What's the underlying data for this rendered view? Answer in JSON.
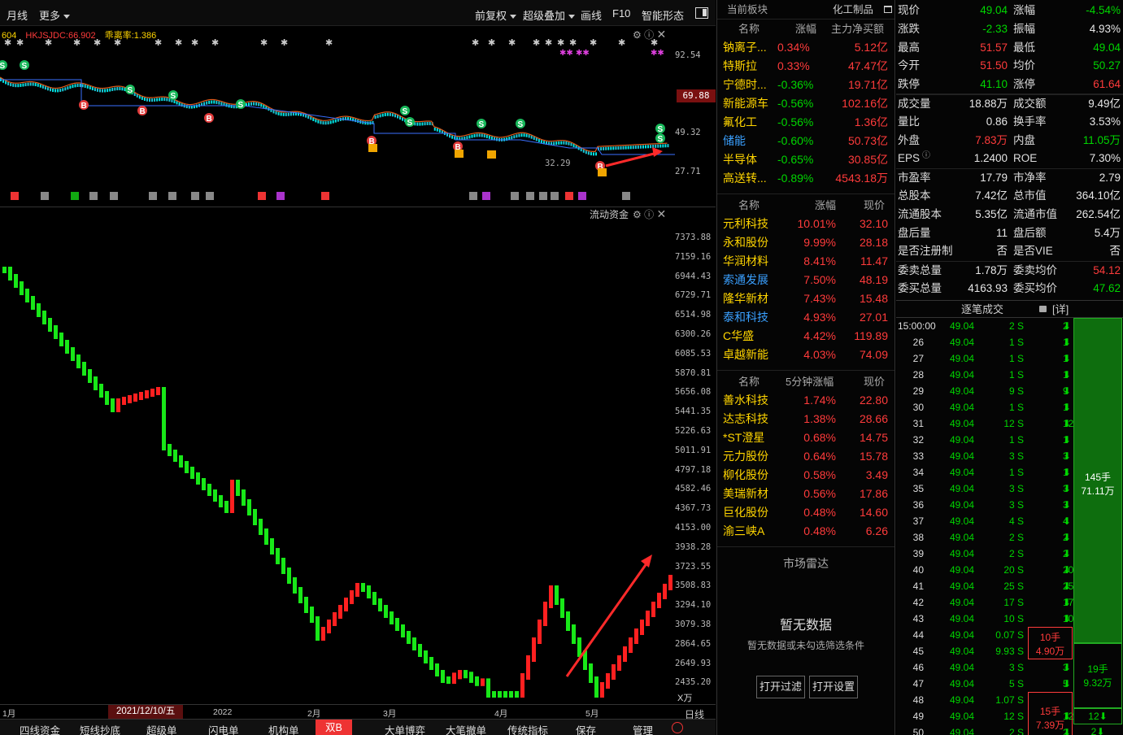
{
  "toolbar": {
    "period": "月线",
    "more": "更多",
    "adjust": "前复权",
    "overlay": "超级叠加",
    "draw": "画线",
    "f10": "F10",
    "smart": "智能形态"
  },
  "upper": {
    "ind_code": "604",
    "ind_name": "HKJSJDC:66.902",
    "ind_bias": "乖离率:1.386",
    "y_labels": [
      "92.54",
      "69.88",
      "49.32",
      "27.71"
    ],
    "current_tag": "69.88",
    "low_label": "32.29"
  },
  "lower": {
    "title": "流动资金",
    "y_labels": [
      "7373.88",
      "7159.16",
      "6944.43",
      "6729.71",
      "6514.98",
      "6300.26",
      "6085.53",
      "5870.81",
      "5656.08",
      "5441.35",
      "5226.63",
      "5011.91",
      "4797.18",
      "4582.46",
      "4367.73",
      "4153.00",
      "3938.28",
      "3723.55",
      "3508.83",
      "3294.10",
      "3079.38",
      "2864.65",
      "2649.93",
      "2435.20"
    ],
    "unit": "X万"
  },
  "xaxis": {
    "labels": [
      "1月",
      "2021/12/10/五",
      "2022",
      "2月",
      "3月",
      "4月",
      "5月"
    ],
    "period_label": "日线"
  },
  "bottom_tabs": [
    "四线资金",
    "短线抄底",
    "超级单",
    "闪电单",
    "机构单",
    "双B",
    "大单博弈",
    "大笔撤单",
    "传统指标",
    "保存",
    "管理"
  ],
  "sector": {
    "header": "当前板块",
    "sector_name": "化工制品",
    "cols": [
      "名称",
      "涨幅",
      "主力净买额"
    ],
    "rows": [
      {
        "name": "钠离子...",
        "pct": "0.34%",
        "val": "5.12亿"
      },
      {
        "name": "特斯拉",
        "pct": "0.33%",
        "val": "47.47亿"
      },
      {
        "name": "宁德时...",
        "pct": "-0.36%",
        "val": "19.71亿"
      },
      {
        "name": "新能源车",
        "pct": "-0.56%",
        "val": "102.16亿"
      },
      {
        "name": "氟化工",
        "pct": "-0.56%",
        "val": "1.36亿"
      },
      {
        "name": "储能",
        "pct": "-0.60%",
        "val": "50.73亿"
      },
      {
        "name": "半导体",
        "pct": "-0.65%",
        "val": "30.85亿"
      },
      {
        "name": "高送转...",
        "pct": "-0.89%",
        "val": "4543.18万"
      }
    ]
  },
  "gainers": {
    "cols": [
      "名称",
      "涨幅",
      "现价"
    ],
    "rows": [
      {
        "name": "元利科技",
        "pct": "10.01%",
        "price": "32.10"
      },
      {
        "name": "永和股份",
        "pct": "9.99%",
        "price": "28.18"
      },
      {
        "name": "华润材料",
        "pct": "8.41%",
        "price": "11.47"
      },
      {
        "name": "索通发展",
        "pct": "7.50%",
        "price": "48.19"
      },
      {
        "name": "隆华新材",
        "pct": "7.43%",
        "price": "15.48"
      },
      {
        "name": "泰和科技",
        "pct": "4.93%",
        "price": "27.01"
      },
      {
        "name": "C华盛",
        "pct": "4.42%",
        "price": "119.89"
      },
      {
        "name": "卓越新能",
        "pct": "4.03%",
        "price": "74.09"
      }
    ]
  },
  "five_min": {
    "cols": [
      "名称",
      "5分钟涨幅",
      "现价"
    ],
    "rows": [
      {
        "name": "善水科技",
        "pct": "1.74%",
        "price": "22.80"
      },
      {
        "name": "达志科技",
        "pct": "1.38%",
        "price": "28.66"
      },
      {
        "name": "*ST澄星",
        "pct": "0.68%",
        "price": "14.75"
      },
      {
        "name": "元力股份",
        "pct": "0.64%",
        "price": "15.78"
      },
      {
        "name": "柳化股份",
        "pct": "0.58%",
        "price": "3.49"
      },
      {
        "name": "美瑞新材",
        "pct": "0.56%",
        "price": "17.86"
      },
      {
        "name": "巨化股份",
        "pct": "0.48%",
        "price": "14.60"
      },
      {
        "name": "渝三峡A",
        "pct": "0.48%",
        "price": "6.26"
      }
    ]
  },
  "radar": {
    "title": "市场雷达",
    "empty": "暂无数据",
    "hint": "暂无数据或未勾选筛选条件",
    "btn_filter": "打开过滤",
    "btn_settings": "打开设置"
  },
  "quote": [
    {
      "l1": "现价",
      "v1": "49.04",
      "l2": "涨幅",
      "v2": "-4.54%"
    },
    {
      "l1": "涨跌",
      "v1": "-2.33",
      "l2": "振幅",
      "v2": "4.93%"
    },
    {
      "l1": "最高",
      "v1": "51.57",
      "l2": "最低",
      "v2": "49.04"
    },
    {
      "l1": "今开",
      "v1": "51.50",
      "l2": "均价",
      "v2": "50.27"
    },
    {
      "l1": "跌停",
      "v1": "41.10",
      "l2": "涨停",
      "v2": "61.64"
    },
    {
      "l1": "成交量",
      "v1": "18.88万",
      "l2": "成交额",
      "v2": "9.49亿"
    },
    {
      "l1": "量比",
      "v1": "0.86",
      "l2": "换手率",
      "v2": "3.53%"
    },
    {
      "l1": "外盘",
      "v1": "7.83万",
      "l2": "内盘",
      "v2": "11.05万"
    },
    {
      "l1": "EPS",
      "v1": "1.2400",
      "l2": "ROE",
      "v2": "7.30%"
    },
    {
      "l1": "市盈率",
      "v1": "17.79",
      "l2": "市净率",
      "v2": "2.79"
    },
    {
      "l1": "总股本",
      "v1": "7.42亿",
      "l2": "总市值",
      "v2": "364.10亿"
    },
    {
      "l1": "流通股本",
      "v1": "5.35亿",
      "l2": "流通市值",
      "v2": "262.54亿"
    },
    {
      "l1": "盘后量",
      "v1": "11",
      "l2": "盘后额",
      "v2": "5.4万"
    },
    {
      "l1": "是否注册制",
      "v1": "否",
      "l2": "是否VIE",
      "v2": "否"
    },
    {
      "l1": "委卖总量",
      "v1": "1.78万",
      "l2": "委卖均价",
      "v2": "54.12"
    },
    {
      "l1": "委买总量",
      "v1": "4163.93",
      "l2": "委买均价",
      "v2": "47.62"
    }
  ],
  "ticks": {
    "title": "逐笔成交",
    "detail": "[详]",
    "rows": [
      {
        "t": "15:00:00",
        "p": "49.04",
        "v": "2 S",
        "n": "2"
      },
      {
        "t": "26",
        "p": "49.04",
        "v": "1 S",
        "n": "1"
      },
      {
        "t": "27",
        "p": "49.04",
        "v": "1 S",
        "n": "1"
      },
      {
        "t": "28",
        "p": "49.04",
        "v": "1 S",
        "n": "1"
      },
      {
        "t": "29",
        "p": "49.04",
        "v": "9 S",
        "n": "9"
      },
      {
        "t": "30",
        "p": "49.04",
        "v": "1 S",
        "n": "1"
      },
      {
        "t": "31",
        "p": "49.04",
        "v": "12 S",
        "n": "12"
      },
      {
        "t": "32",
        "p": "49.04",
        "v": "1 S",
        "n": "1"
      },
      {
        "t": "33",
        "p": "49.04",
        "v": "3 S",
        "n": "3"
      },
      {
        "t": "34",
        "p": "49.04",
        "v": "1 S",
        "n": "1"
      },
      {
        "t": "35",
        "p": "49.04",
        "v": "3 S",
        "n": "3"
      },
      {
        "t": "36",
        "p": "49.04",
        "v": "3 S",
        "n": "3"
      },
      {
        "t": "37",
        "p": "49.04",
        "v": "4 S",
        "n": "4"
      },
      {
        "t": "38",
        "p": "49.04",
        "v": "2 S",
        "n": "2"
      },
      {
        "t": "39",
        "p": "49.04",
        "v": "2 S",
        "n": "2"
      },
      {
        "t": "40",
        "p": "49.04",
        "v": "20 S",
        "n": "20"
      },
      {
        "t": "41",
        "p": "49.04",
        "v": "25 S",
        "n": "25"
      },
      {
        "t": "42",
        "p": "49.04",
        "v": "17 S",
        "n": "17"
      },
      {
        "t": "43",
        "p": "49.04",
        "v": "10 S",
        "n": "10"
      },
      {
        "t": "44",
        "p": "49.04",
        "v": "0.07 S",
        "n": ""
      },
      {
        "t": "45",
        "p": "49.04",
        "v": "9.93 S",
        "n": ""
      },
      {
        "t": "46",
        "p": "49.04",
        "v": "3 S",
        "n": "3"
      },
      {
        "t": "47",
        "p": "49.04",
        "v": "5 S",
        "n": "5"
      },
      {
        "t": "48",
        "p": "49.04",
        "v": "1.07 S",
        "n": ""
      },
      {
        "t": "49",
        "p": "49.04",
        "v": "12 S",
        "n": "12"
      },
      {
        "t": "50",
        "p": "49.04",
        "v": "2 S",
        "n": "2"
      }
    ],
    "box1_a": "10手",
    "box1_b": "4.90万",
    "box2_a": "15手",
    "box2_b": "7.39万",
    "big_a": "145手",
    "big_b": "71.11万",
    "mid_a": "19手",
    "mid_b": "9.32万",
    "small_a": "12",
    "small_b": "2"
  }
}
